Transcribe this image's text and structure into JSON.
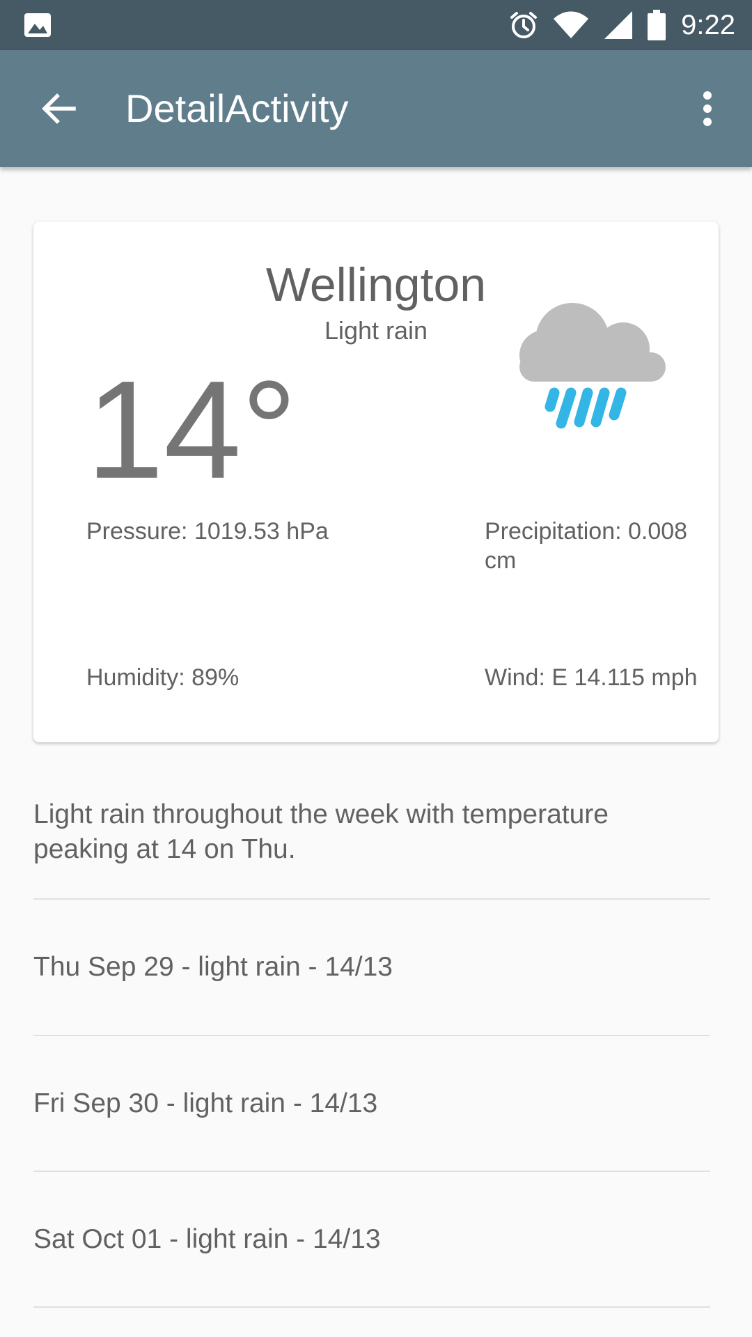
{
  "status_bar": {
    "time": "9:22",
    "icons": [
      "gallery-icon",
      "alarm-icon",
      "wifi-icon",
      "cellular-icon",
      "battery-icon"
    ]
  },
  "app_bar": {
    "title": "DetailActivity",
    "back_icon": "arrow-back-icon",
    "overflow_icon": "more-vert-icon",
    "background": "#607d8b"
  },
  "weather": {
    "city": "Wellington",
    "condition": "Light rain",
    "temperature": "14°",
    "icon": "rain-cloud-icon",
    "pressure": "Pressure: 1019.53 hPa",
    "precipitation": "Precipitation: 0.008 cm",
    "humidity": "Humidity: 89%",
    "wind": "Wind: E 14.115 mph"
  },
  "summary": "Light rain throughout the week with temperature peaking at 14 on Thu.",
  "forecast": [
    {
      "label": "Thu Sep 29 - light rain - 14/13"
    },
    {
      "label": "Fri Sep 30 - light rain - 14/13"
    },
    {
      "label": "Sat Oct 01 - light rain - 14/13"
    }
  ],
  "colors": {
    "status_bar": "#455a64",
    "rain_drops": "#33b5e5",
    "cloud": "#bdbdbd"
  }
}
